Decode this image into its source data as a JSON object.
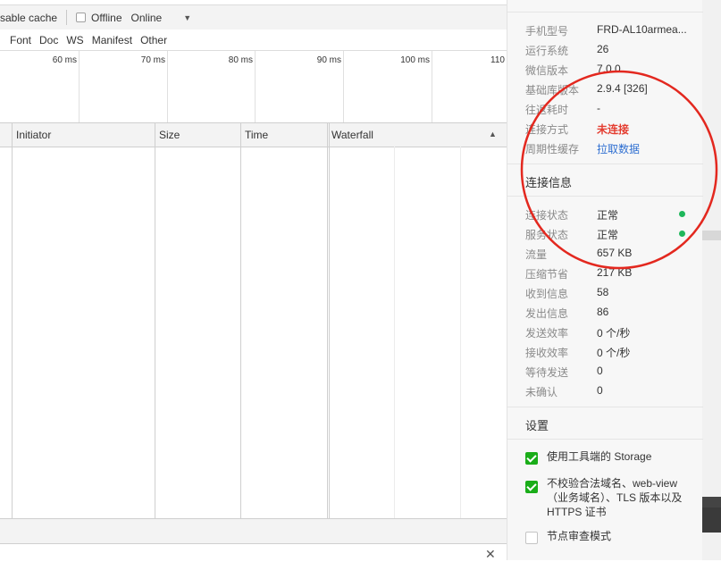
{
  "toolbar": {
    "disable_cache_label": "sable cache",
    "offline_label": "Offline",
    "throttle_value": "Online"
  },
  "filters": [
    "Font",
    "Doc",
    "WS",
    "Manifest",
    "Other"
  ],
  "timeline": {
    "ticks": [
      "60 ms",
      "70 ms",
      "80 ms",
      "90 ms",
      "100 ms",
      "110"
    ]
  },
  "columns": {
    "initiator": "Initiator",
    "size": "Size",
    "time": "Time",
    "waterfall": "Waterfall"
  },
  "info": {
    "rows": [
      {
        "key": "手机型号",
        "value": "FRD-AL10armea..."
      },
      {
        "key": "运行系统",
        "value": "26"
      },
      {
        "key": "微信版本",
        "value": "7.0.0"
      },
      {
        "key": "基础库版本",
        "value": "2.9.4 [326]"
      },
      {
        "key": "往返耗时",
        "value": "-"
      },
      {
        "key": "连接方式",
        "value": "未连接"
      },
      {
        "key": "周期性缓存",
        "value": "拉取数据"
      }
    ]
  },
  "connection": {
    "title": "连接信息",
    "rows": [
      {
        "key": "连接状态",
        "value": "正常"
      },
      {
        "key": "服务状态",
        "value": "正常"
      },
      {
        "key": "流量",
        "value": "657 KB"
      },
      {
        "key": "压缩节省",
        "value": "217 KB"
      },
      {
        "key": "收到信息",
        "value": "58"
      },
      {
        "key": "发出信息",
        "value": "86"
      },
      {
        "key": "发送效率",
        "value": "0 个/秒"
      },
      {
        "key": "接收效率",
        "value": "0 个/秒"
      },
      {
        "key": "等待发送",
        "value": "0"
      },
      {
        "key": "未确认",
        "value": "0"
      }
    ]
  },
  "settings": {
    "title": "设置",
    "options": [
      {
        "label": "使用工具端的 Storage",
        "checked": true
      },
      {
        "label": "不校验合法域名、web-view（业务域名）、TLS 版本以及 HTTPS 证书",
        "checked": true
      },
      {
        "label": "节点审查模式",
        "checked": false
      }
    ]
  },
  "colors": {
    "accent_green": "#1aad19",
    "status_dot": "#1fb75b",
    "error_red": "#e43d30",
    "link_blue": "#2f6fd1",
    "annotation_red": "#e3281f"
  }
}
